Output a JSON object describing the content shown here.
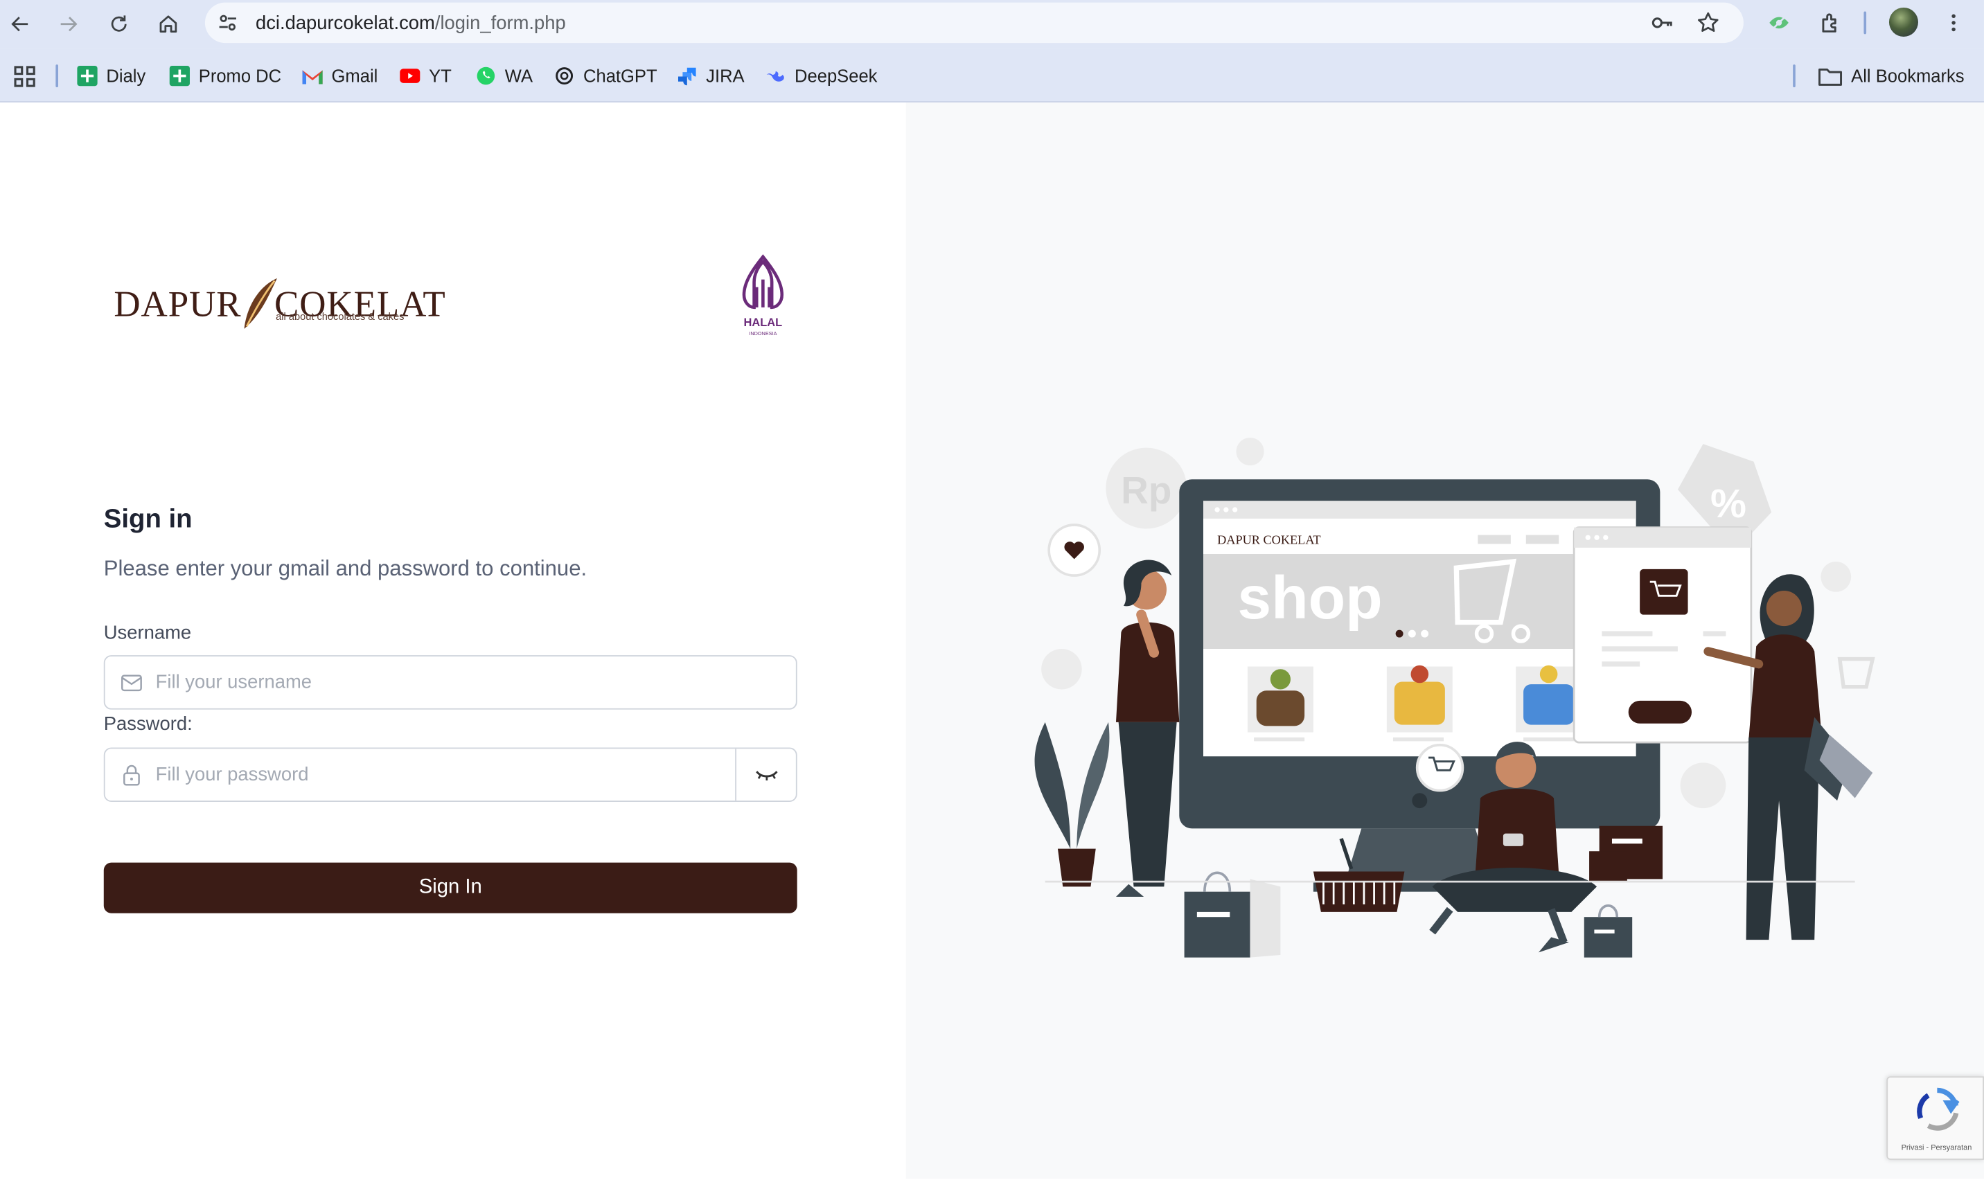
{
  "browser": {
    "url_host": "dci.dapurcokelat.com",
    "url_path": "/login_form.php",
    "bookmarks": [
      {
        "label": "Dialy",
        "icon": "sheets-icon"
      },
      {
        "label": "Promo DC",
        "icon": "sheets-icon"
      },
      {
        "label": "Gmail",
        "icon": "gmail-icon"
      },
      {
        "label": "YT",
        "icon": "youtube-icon"
      },
      {
        "label": "WA",
        "icon": "whatsapp-icon"
      },
      {
        "label": "ChatGPT",
        "icon": "chatgpt-icon"
      },
      {
        "label": "JIRA",
        "icon": "jira-icon"
      },
      {
        "label": "DeepSeek",
        "icon": "deepseek-icon"
      }
    ],
    "all_bookmarks_label": "All Bookmarks"
  },
  "brand": {
    "name_left": "DAPUR",
    "name_right": "COKELAT",
    "tagline": "all about chocolates & cakes",
    "halal_label": "HALAL",
    "halal_sub": "INDONESIA",
    "color": "#3b1c16"
  },
  "login": {
    "title": "Sign in",
    "subtitle": "Please enter your gmail and password to continue.",
    "username_label": "Username",
    "username_placeholder": "Fill your username",
    "password_label": "Password:",
    "password_placeholder": "Fill your password",
    "submit_label": "Sign In"
  },
  "illustration": {
    "brand_small": "DAPUR COKELAT",
    "shop_word": "shop",
    "currency_badge": "Rp",
    "discount_tag": "%"
  },
  "recaptcha": {
    "footer": "Privasi - Persyaratan"
  }
}
